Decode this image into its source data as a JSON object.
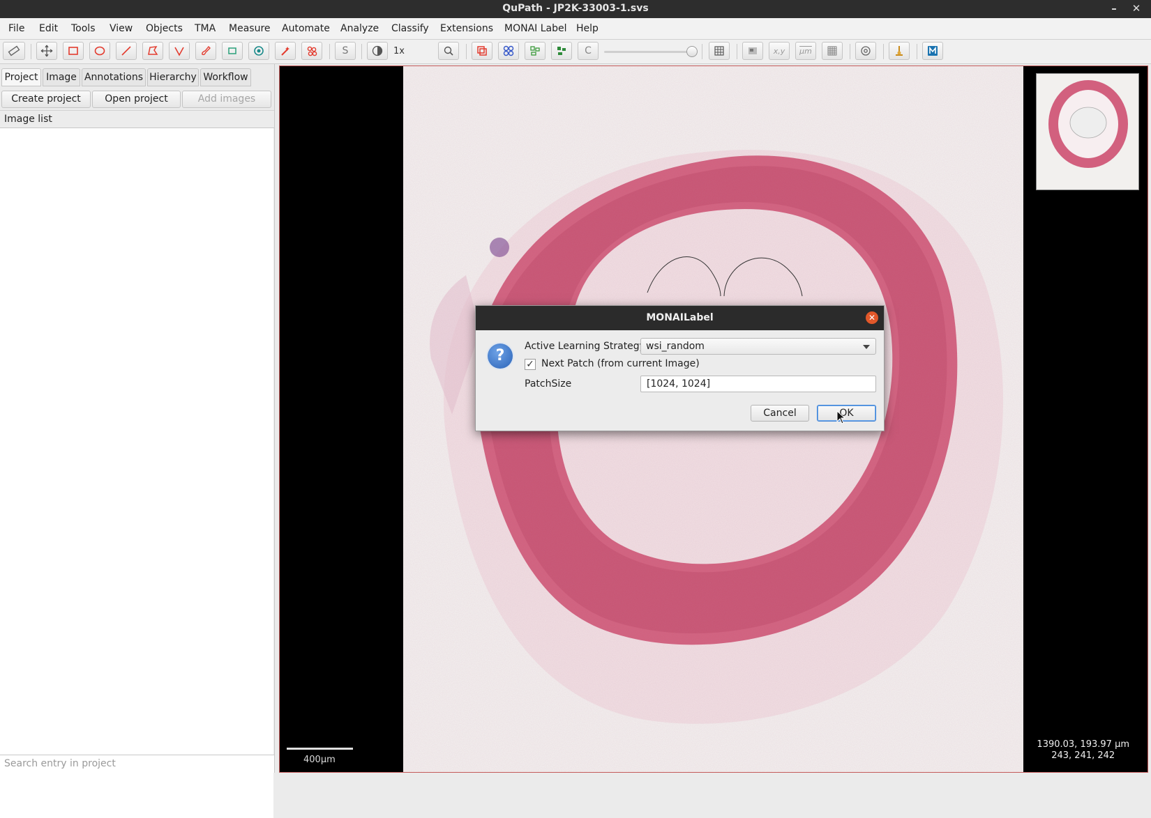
{
  "window": {
    "title": "QuPath - JP2K-33003-1.svs",
    "minimize_glyph": "–",
    "close_glyph": "✕"
  },
  "menubar": {
    "items": [
      "File",
      "Edit",
      "Tools",
      "View",
      "Objects",
      "TMA",
      "Measure",
      "Automate",
      "Analyze",
      "Classify",
      "Extensions",
      "MONAI Label",
      "Help"
    ]
  },
  "toolbar": {
    "zoom_label": "1x",
    "accent_color": "#e33b2e",
    "icons": [
      "measure-ruler-icon",
      "move-icon",
      "rectangle-icon",
      "ellipse-icon",
      "line-icon",
      "polygon-icon",
      "polyline-icon",
      "brush-icon",
      "wand-icon",
      "points-icon",
      "selection-mode-icon",
      "brightness-contrast-icon",
      "zoom-to-fit-icon",
      "show-annotations-icon",
      "show-tma-grid-icon",
      "show-detections-icon",
      "fill-detections-icon",
      "show-connections-icon",
      "opacity-slider",
      "grid-icon",
      "overview-icon",
      "location-icon",
      "scalebar-icon",
      "counting-grid-icon",
      "settings-icon",
      "log-icon",
      "monai-icon"
    ],
    "letter_s": "S",
    "letter_c": "C",
    "xy": "x,y",
    "um": "μm"
  },
  "left_panel": {
    "tabs": [
      "Project",
      "Image",
      "Annotations",
      "Hierarchy",
      "Workflow"
    ],
    "active_tab": "Project",
    "buttons": {
      "create": "Create project",
      "open": "Open project",
      "add": "Add images"
    },
    "image_list_header": "Image list",
    "search_placeholder": "Search entry in project"
  },
  "viewer": {
    "scalebar_label": "400μm",
    "coords_line1": "1390.03, 193.97 μm",
    "coords_line2": "243, 241, 242",
    "stain_color": "#d2607e"
  },
  "dialog": {
    "title": "MONAILabel",
    "strategy_label": "Active Learning Strategy",
    "strategy_value": "wsi_random",
    "next_patch_label": "Next Patch (from current Image)",
    "next_patch_checked": true,
    "check_glyph": "✓",
    "patchsize_label": "PatchSize",
    "patchsize_value": "[1024, 1024]",
    "cancel_label": "Cancel",
    "ok_label": "OK",
    "question_glyph": "?",
    "close_glyph": "✕"
  }
}
